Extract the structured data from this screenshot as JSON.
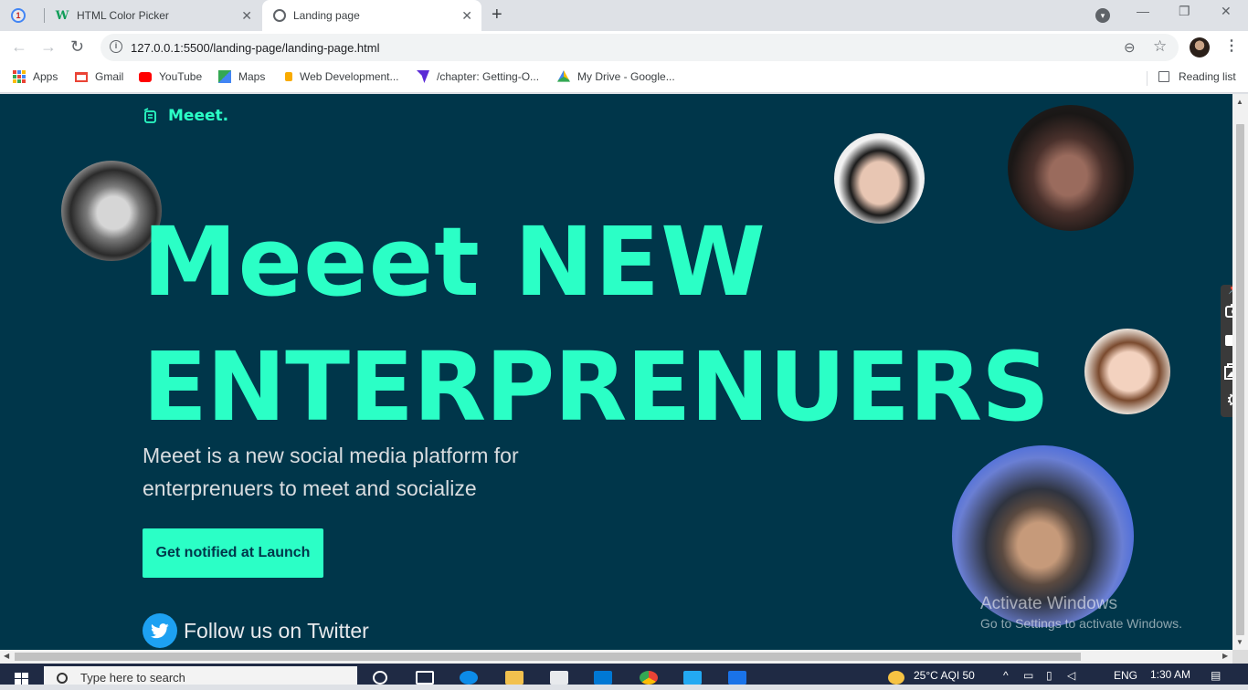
{
  "browser": {
    "tabs": [
      {
        "title": "",
        "icon": "gmail-icon"
      },
      {
        "title": "HTML Color Picker",
        "icon": "w3schools-icon"
      },
      {
        "title": "Landing page",
        "icon": "globe-icon",
        "active": true
      }
    ],
    "url": "127.0.0.1:5500/landing-page/landing-page.html",
    "bookmarks": [
      {
        "label": "Apps",
        "icon": "apps-grid-icon"
      },
      {
        "label": "Gmail",
        "icon": "gmail-icon"
      },
      {
        "label": "YouTube",
        "icon": "youtube-icon"
      },
      {
        "label": "Maps",
        "icon": "maps-icon"
      },
      {
        "label": "Web Development...",
        "icon": "bookmark-icon"
      },
      {
        "label": "/chapter: Getting-O...",
        "icon": "bookmark-icon"
      },
      {
        "label": "My Drive - Google...",
        "icon": "drive-icon"
      }
    ],
    "reading_list": "Reading list"
  },
  "page": {
    "logo_text": "Meeet.",
    "headline_line1": "Meeet NEW",
    "headline_line2": "ENTERPRENUERS",
    "subtext": "Meeet is a new social media platform for enterprenuers to meet and socialize",
    "cta_label": "Get notified at Launch",
    "twitter_label": "Follow us on Twitter"
  },
  "watermark": {
    "line1": "Activate Windows",
    "line2": "Go to Settings to activate Windows."
  },
  "taskbar": {
    "search_placeholder": "Type here to search",
    "weather": "25°C  AQI 50",
    "language": "ENG",
    "time": "1:30 AM"
  },
  "colors": {
    "page_bg": "#00364a",
    "accent": "#2bffc6",
    "twitter": "#1da1f2"
  }
}
